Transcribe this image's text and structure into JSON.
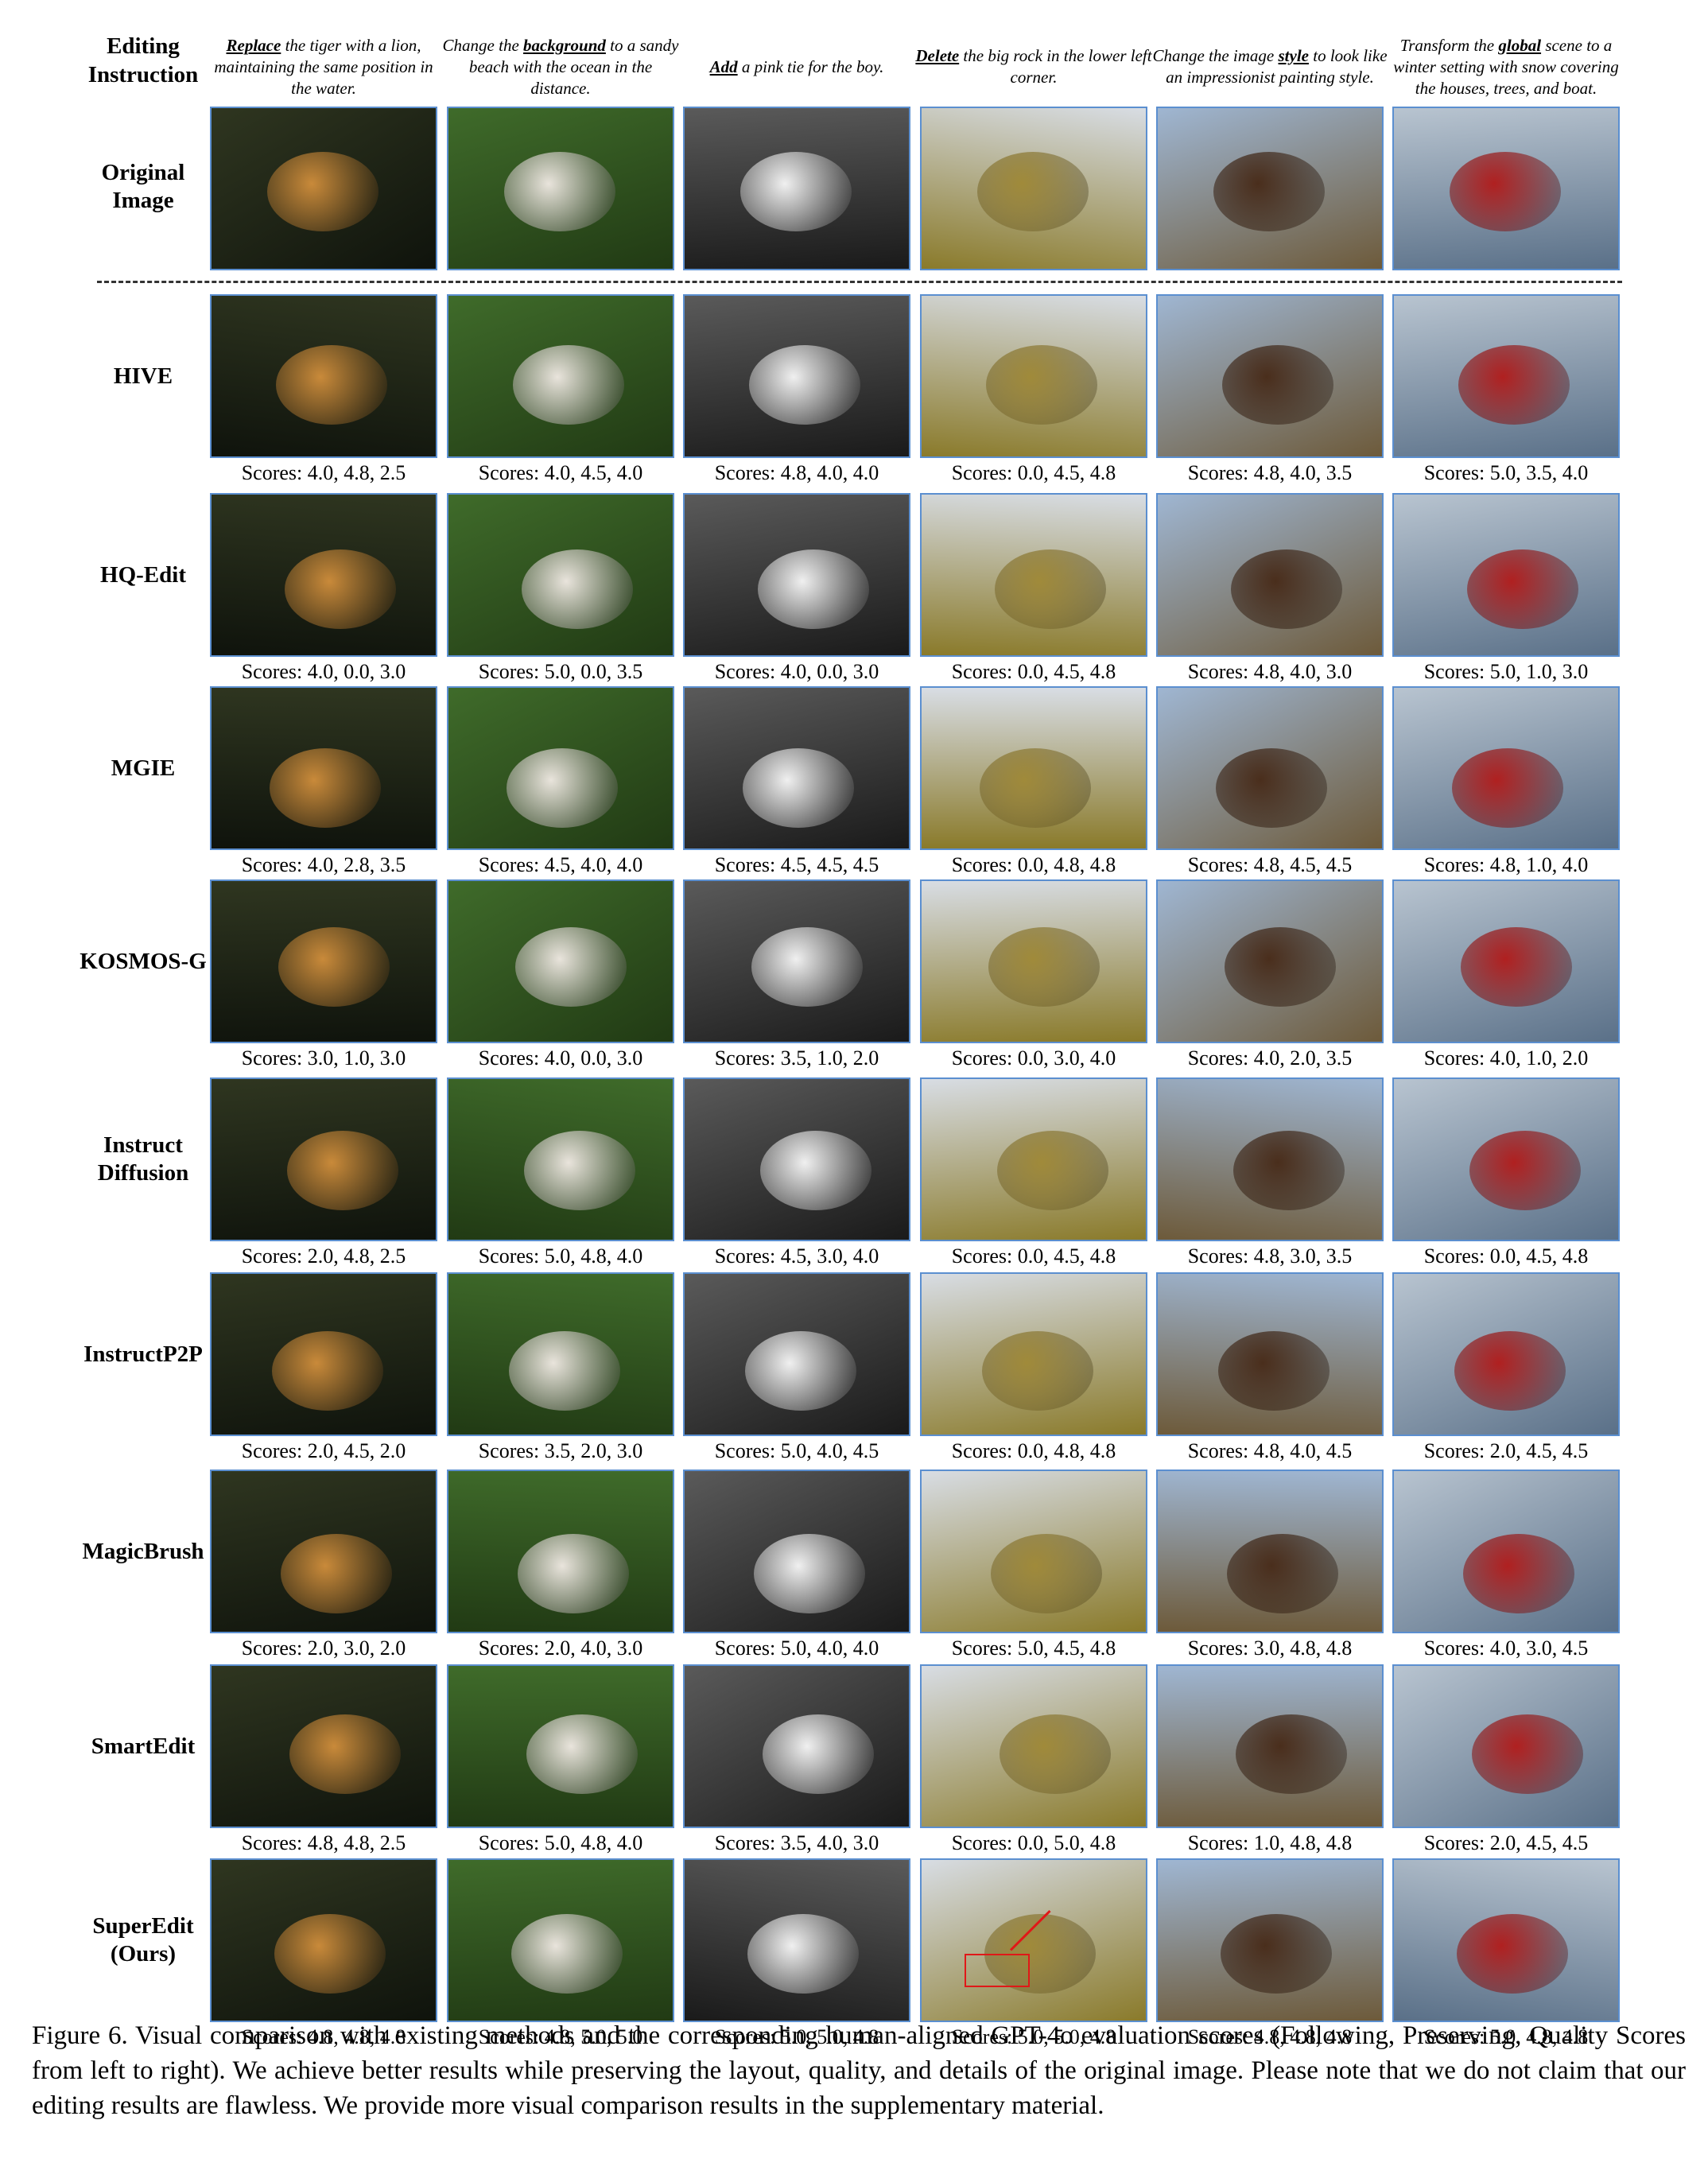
{
  "header": {
    "editing_instruction_label": [
      "Editing",
      "Instruction"
    ],
    "original_label": [
      "Original",
      "Image"
    ]
  },
  "instructions": [
    {
      "pre": "",
      "kw": "Replace",
      "post": " the tiger with a lion, maintaining the same position in the water."
    },
    {
      "pre": "Change the ",
      "kw": "background",
      "post": " to a sandy beach with the ocean in the distance."
    },
    {
      "pre": "",
      "kw": "Add",
      "post": " a pink tie for the boy."
    },
    {
      "pre": "",
      "kw": "Delete",
      "post": " the big rock in the lower left corner."
    },
    {
      "pre": "Change the image ",
      "kw": "style",
      "post": " to look like an impressionist painting style."
    },
    {
      "pre": "Transform the ",
      "kw": "global",
      "post": " scene to a winter setting with snow covering the houses, trees, and boat."
    }
  ],
  "columns": [
    {
      "subject": "tiger in water",
      "scene": [
        "#2f3620",
        "#0f130c"
      ],
      "subj": "#c98a3a"
    },
    {
      "subject": "bulldog with yellow ball",
      "scene": [
        "#3f6b2a",
        "#213a14"
      ],
      "subj": "#e9e4dc"
    },
    {
      "subject": "boy with glasses",
      "scene": [
        "#5a5a5a",
        "#1a1a1a"
      ],
      "subj": "#f0f0f0"
    },
    {
      "subject": "mountain valley",
      "scene": [
        "#d8dde4",
        "#8a7a2a"
      ],
      "subj": "#a08a3a"
    },
    {
      "subject": "rider on horse",
      "scene": [
        "#9fb6d2",
        "#6d5a3a"
      ],
      "subj": "#4a2e1c"
    },
    {
      "subject": "boat on lake with houses",
      "scene": [
        "#b8c4d0",
        "#5a7088"
      ],
      "subj": "#b02020"
    }
  ],
  "methods": [
    {
      "label": [
        "HIVE"
      ],
      "scores": [
        "Scores: 4.0, 4.8, 2.5",
        "Scores: 4.0, 4.5, 4.0",
        "Scores: 4.8, 4.0, 4.0",
        "Scores: 0.0, 4.5, 4.8",
        "Scores: 4.8, 4.0, 3.5",
        "Scores: 5.0, 3.5, 4.0"
      ]
    },
    {
      "label": [
        "HQ-Edit"
      ],
      "scores": [
        "Scores: 4.0, 0.0, 3.0",
        "Scores: 5.0, 0.0, 3.5",
        "Scores: 4.0, 0.0, 3.0",
        "Scores: 0.0, 4.5, 4.8",
        "Scores: 4.8, 4.0, 3.0",
        "Scores: 5.0, 1.0, 3.0"
      ]
    },
    {
      "label": [
        "MGIE"
      ],
      "scores": [
        "Scores: 4.0, 2.8, 3.5",
        "Scores: 4.5, 4.0, 4.0",
        "Scores: 4.5, 4.5, 4.5",
        "Scores: 0.0, 4.8, 4.8",
        "Scores: 4.8, 4.5, 4.5",
        "Scores: 4.8, 1.0, 4.0"
      ]
    },
    {
      "label": [
        "KOSMOS-G"
      ],
      "scores": [
        "Scores: 3.0, 1.0, 3.0",
        "Scores: 4.0, 0.0, 3.0",
        "Scores: 3.5, 1.0, 2.0",
        "Scores: 0.0, 3.0, 4.0",
        "Scores: 4.0, 2.0, 3.5",
        "Scores: 4.0, 1.0, 2.0"
      ]
    },
    {
      "label": [
        "Instruct",
        "Diffusion"
      ],
      "scores": [
        "Scores: 2.0, 4.8, 2.5",
        "Scores: 5.0, 4.8, 4.0",
        "Scores: 4.5, 3.0, 4.0",
        "Scores: 0.0, 4.5, 4.8",
        "Scores: 4.8, 3.0, 3.5",
        "Scores: 0.0, 4.5, 4.8"
      ]
    },
    {
      "label": [
        "InstructP2P"
      ],
      "scores": [
        "Scores: 2.0, 4.5, 2.0",
        "Scores: 3.5, 2.0, 3.0",
        "Scores: 5.0, 4.0, 4.5",
        "Scores: 0.0, 4.8, 4.8",
        "Scores: 4.8, 4.0, 4.5",
        "Scores: 2.0, 4.5, 4.5"
      ]
    },
    {
      "label": [
        "MagicBrush"
      ],
      "scores": [
        "Scores: 2.0, 3.0, 2.0",
        "Scores: 2.0, 4.0, 3.0",
        "Scores: 5.0, 4.0, 4.0",
        "Scores: 5.0, 4.5, 4.8",
        "Scores: 3.0, 4.8, 4.8",
        "Scores: 4.0, 3.0, 4.5"
      ]
    },
    {
      "label": [
        "SmartEdit"
      ],
      "scores": [
        "Scores: 4.8, 4.8, 2.5",
        "Scores: 5.0, 4.8, 4.0",
        "Scores: 3.5, 4.0, 3.0",
        "Scores: 0.0, 5.0, 4.8",
        "Scores: 1.0, 4.8, 4.8",
        "Scores: 2.0, 4.5, 4.5"
      ]
    },
    {
      "label": [
        "SuperEdit",
        "(Ours)"
      ],
      "scores": [
        "Scores: 4.8, 4.8, 4.8",
        "Scores: 4.8, 5.0, 5.0",
        "Scores: 5.0, 5.0, 4.8",
        "Scores: 5.0, 5.0, 4.8",
        "Scores: 4.8, 4.8, 4.8",
        "Scores: 5.0, 4.8, 4.8"
      ]
    }
  ],
  "caption": "Figure 6. Visual comparison with existing methods and the corresponding human-aligned GPT-4o evaluation scores (Following, Preserving, Quality Scores from left to right). We achieve better results while preserving the layout, quality, and details of the original image. Please note that we do not claim that our editing results are flawless. We provide more visual comparison results in the supplementary material.",
  "colors": {
    "thumb_border": "#5b8fd0",
    "highlight": "#e01818",
    "divider": "#333333"
  }
}
